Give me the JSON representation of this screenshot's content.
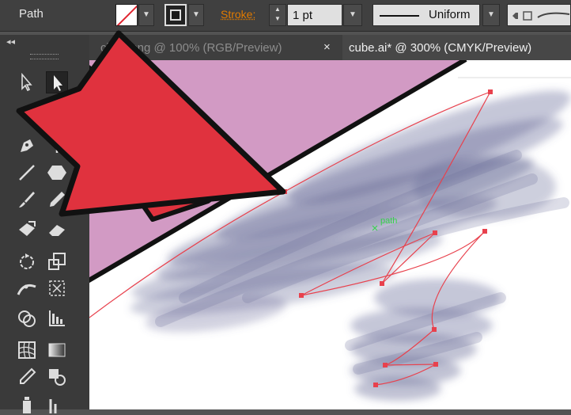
{
  "control_bar": {
    "selection_label": "Path",
    "fill_dropdown": "▼",
    "stroke_dropdown": "▼",
    "stroke_label": "Stroke:",
    "stroke_weight": "1 pt",
    "weight_dropdown": "▼",
    "profile_label": "Uniform",
    "profile_dropdown": "▼"
  },
  "toolbox": {
    "collapse_label": "◂◂"
  },
  "tabs": [
    {
      "label": "clock.png @ 100% (RGB/Preview)",
      "close": "×"
    },
    {
      "label": "cube.ai* @ 300% (CMYK/Preview)"
    }
  ],
  "canvas": {
    "smart_guide_label": "path"
  },
  "colors": {
    "ui_dark": "#404040",
    "accent_orange": "#e07a00",
    "shape_fill": "#d29ac4",
    "arrow_red": "#e0323e",
    "path_red": "#e8414d",
    "smudge": "#5d5f8e"
  },
  "icons": [
    "selection-icon",
    "direct-selection-icon",
    "pen-icon",
    "type-icon",
    "line-segment-icon",
    "polygon-icon",
    "paintbrush-icon",
    "pencil-icon",
    "blob-brush-icon",
    "eraser-icon",
    "rotate-icon",
    "scale-icon",
    "width-icon",
    "free-transform-icon",
    "shape-builder-icon",
    "graph-icon",
    "mesh-icon",
    "gradient-icon",
    "eyedropper-icon",
    "blend-icon"
  ]
}
